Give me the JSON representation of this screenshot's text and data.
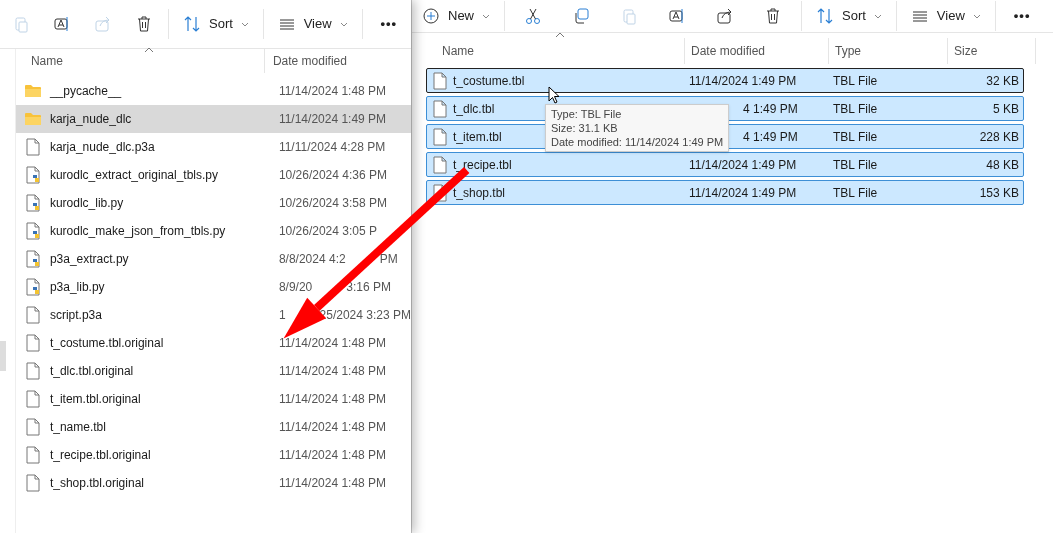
{
  "left_window": {
    "toolbar": [
      {
        "kind": "paste",
        "disabled": true
      },
      {
        "kind": "rename",
        "disabled": false
      },
      {
        "kind": "share",
        "disabled": true
      },
      {
        "kind": "delete",
        "disabled": false
      },
      {
        "kind": "sort",
        "label": "Sort"
      },
      {
        "kind": "view",
        "label": "View"
      },
      {
        "kind": "more",
        "label": "•••"
      }
    ],
    "columns": [
      "Name",
      "Date modified"
    ],
    "rows": [
      {
        "kind": "folder",
        "name": "__pycache__",
        "date": [
          "11/14/2024 1:48 PM"
        ],
        "selected": false
      },
      {
        "kind": "folder",
        "name": "karja_nude_dlc",
        "date": [
          "11/14/2024 1:49 PM"
        ],
        "selected": true
      },
      {
        "kind": "file",
        "name": "karja_nude_dlc.p3a",
        "date": [
          "11/11/2024 4:28 PM"
        ],
        "selected": false
      },
      {
        "kind": "python",
        "name": "kurodlc_extract_original_tbls.py",
        "date": [
          "10/26/2024 4:36 PM"
        ],
        "selected": false
      },
      {
        "kind": "python",
        "name": "kurodlc_lib.py",
        "date": [
          "10/26/2024 3:58 PM"
        ],
        "selected": false
      },
      {
        "kind": "python",
        "name": "kurodlc_make_json_from_tbls.py",
        "date": [
          "10/26/2024 3:05 P"
        ],
        "selected": false
      },
      {
        "kind": "python",
        "name": "p3a_extract.py",
        "date": [
          "8/8/2024 4:2",
          "PM"
        ],
        "selected": false
      },
      {
        "kind": "python",
        "name": "p3a_lib.py",
        "date": [
          "8/9/20",
          "3:16 PM"
        ],
        "selected": false
      },
      {
        "kind": "file",
        "name": "script.p3a",
        "date": [
          "1",
          "25/2024 3:23 PM"
        ],
        "selected": false
      },
      {
        "kind": "file",
        "name": "t_costume.tbl.original",
        "date": [
          "11/14/2024 1:48 PM"
        ],
        "selected": false
      },
      {
        "kind": "file",
        "name": "t_dlc.tbl.original",
        "date": [
          "11/14/2024 1:48 PM"
        ],
        "selected": false
      },
      {
        "kind": "file",
        "name": "t_item.tbl.original",
        "date": [
          "11/14/2024 1:48 PM"
        ],
        "selected": false
      },
      {
        "kind": "file",
        "name": "t_name.tbl",
        "date": [
          "11/14/2024 1:48 PM"
        ],
        "selected": false
      },
      {
        "kind": "file",
        "name": "t_recipe.tbl.original",
        "date": [
          "11/14/2024 1:48 PM"
        ],
        "selected": false
      },
      {
        "kind": "file",
        "name": "t_shop.tbl.original",
        "date": [
          "11/14/2024 1:48 PM"
        ],
        "selected": false
      }
    ]
  },
  "right_window": {
    "toolbar": [
      {
        "kind": "new",
        "label": "New"
      },
      {
        "kind": "cut",
        "disabled": false
      },
      {
        "kind": "copy",
        "disabled": false
      },
      {
        "kind": "paste",
        "disabled": true
      },
      {
        "kind": "rename",
        "disabled": false
      },
      {
        "kind": "share",
        "disabled": false
      },
      {
        "kind": "delete",
        "disabled": false
      },
      {
        "kind": "sort",
        "label": "Sort"
      },
      {
        "kind": "view",
        "label": "View"
      },
      {
        "kind": "more",
        "label": "•••"
      }
    ],
    "columns": [
      "Name",
      "Date modified",
      "Type",
      "Size"
    ],
    "rows": [
      {
        "name": "t_costume.tbl",
        "date": "11/14/2024 1:49 PM",
        "type": "TBL File",
        "size": "32 KB",
        "selected": true
      },
      {
        "name": "t_dlc.tbl",
        "date": "4 1:49 PM",
        "type": "TBL File",
        "size": "5 KB",
        "selected": true
      },
      {
        "name": "t_item.tbl",
        "date": "4 1:49 PM",
        "type": "TBL File",
        "size": "228 KB",
        "selected": true
      },
      {
        "name": "t_recipe.tbl",
        "date": "11/14/2024 1:49 PM",
        "type": "TBL File",
        "size": "48 KB",
        "selected": true
      },
      {
        "name": "t_shop.tbl",
        "date": "11/14/2024 1:49 PM",
        "type": "TBL File",
        "size": "153 KB",
        "selected": true
      }
    ],
    "tooltip": [
      "Type: TBL File",
      "Size: 31.1 KB",
      "Date modified: 11/14/2024 1:49 PM"
    ]
  }
}
